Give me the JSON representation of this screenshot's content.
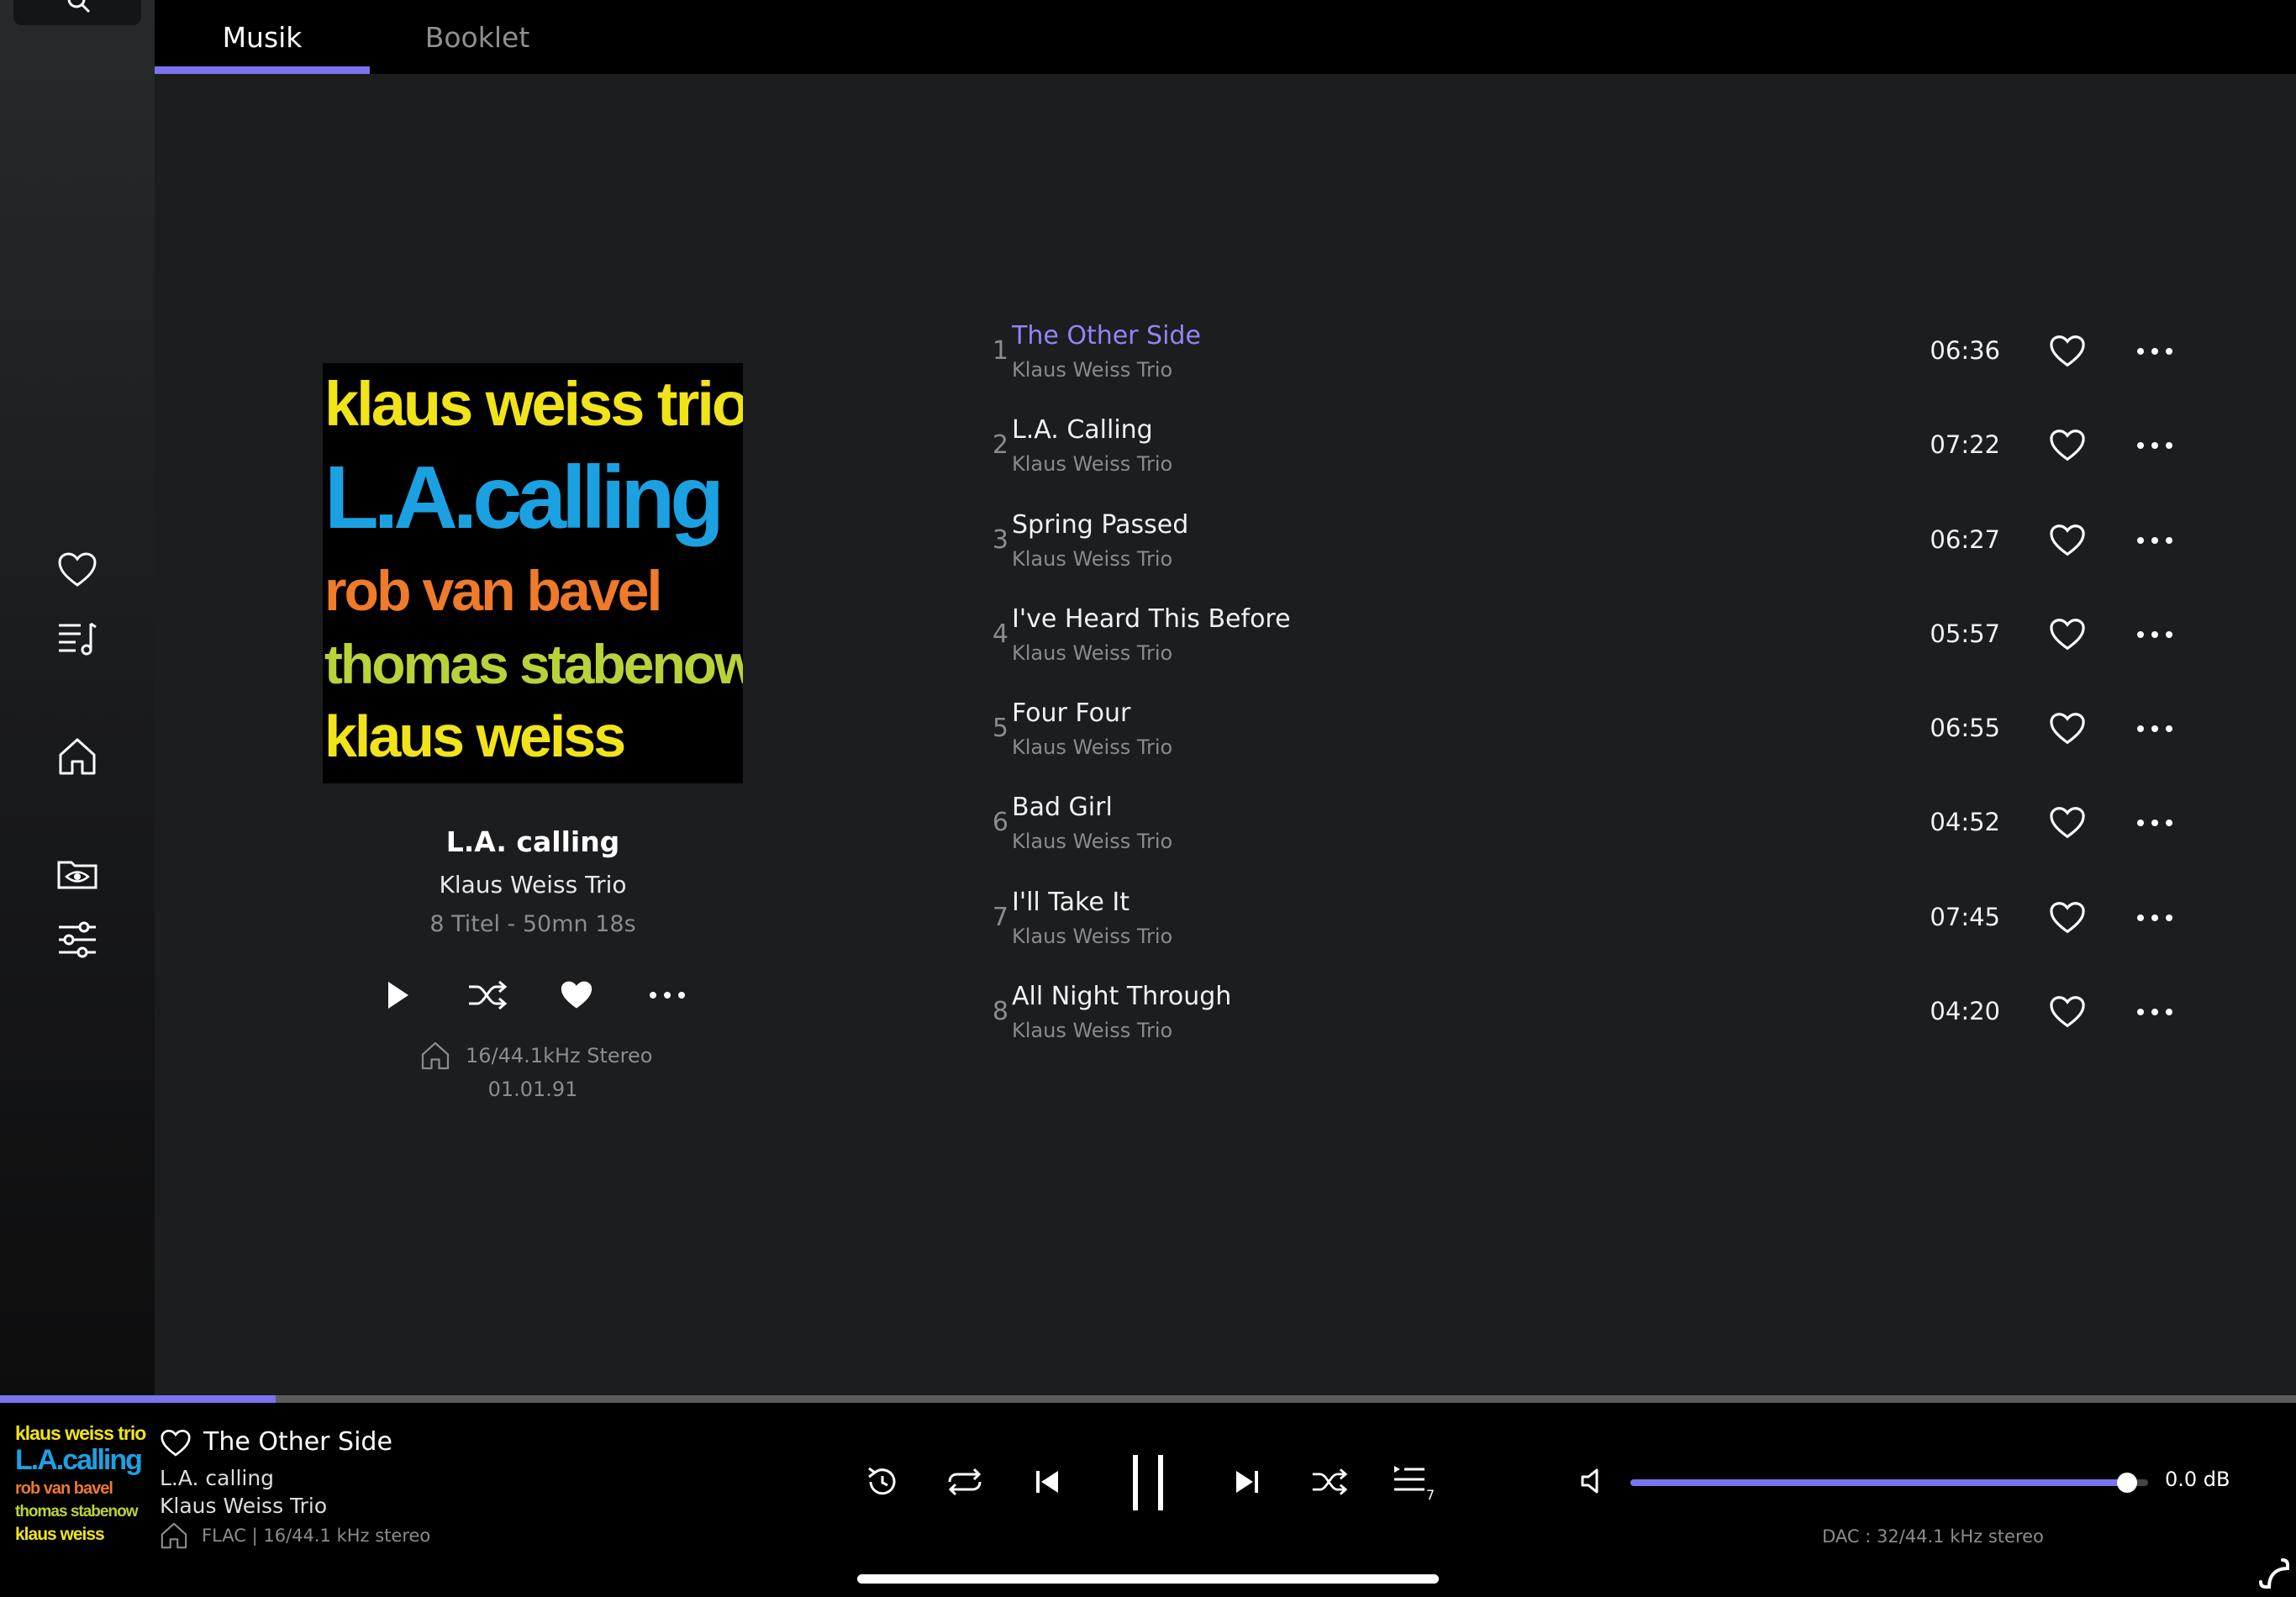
{
  "tabs": [
    {
      "label": "Musik",
      "active": true
    },
    {
      "label": "Booklet",
      "active": false
    }
  ],
  "sidebar": {
    "items": [
      {
        "icon": "heart-icon"
      },
      {
        "icon": "playlist-icon"
      },
      {
        "icon": "home-icon"
      },
      {
        "icon": "folder-eye-icon"
      },
      {
        "icon": "sliders-icon"
      }
    ]
  },
  "album": {
    "cover_lines": [
      "klaus weiss trio",
      "L.A.calling",
      "rob van bavel",
      "thomas stabenow",
      "klaus weiss"
    ],
    "title": "L.A. calling",
    "artist": "Klaus Weiss Trio",
    "meta": "8 Titel - 50mn 18s",
    "format": "16/44.1kHz Stereo",
    "date": "01.01.91"
  },
  "tracks": [
    {
      "num": "1",
      "title": "The Other Side",
      "artist": "Klaus Weiss Trio",
      "duration": "06:36",
      "playing": true
    },
    {
      "num": "2",
      "title": "L.A. Calling",
      "artist": "Klaus Weiss Trio",
      "duration": "07:22",
      "playing": false
    },
    {
      "num": "3",
      "title": "Spring Passed",
      "artist": "Klaus Weiss Trio",
      "duration": "06:27",
      "playing": false
    },
    {
      "num": "4",
      "title": "I've Heard This Before",
      "artist": "Klaus Weiss Trio",
      "duration": "05:57",
      "playing": false
    },
    {
      "num": "5",
      "title": "Four Four",
      "artist": "Klaus Weiss Trio",
      "duration": "06:55",
      "playing": false
    },
    {
      "num": "6",
      "title": "Bad Girl",
      "artist": "Klaus Weiss Trio",
      "duration": "04:52",
      "playing": false
    },
    {
      "num": "7",
      "title": "I'll Take It",
      "artist": "Klaus Weiss Trio",
      "duration": "07:45",
      "playing": false
    },
    {
      "num": "8",
      "title": "All Night Through",
      "artist": "Klaus Weiss Trio",
      "duration": "04:20",
      "playing": false
    }
  ],
  "now_playing": {
    "title": "The Other Side",
    "album": "L.A. calling",
    "artist": "Klaus Weiss Trio",
    "format": "FLAC | 16/44.1 kHz stereo",
    "progress": 0.12,
    "queue_count": "7"
  },
  "volume": {
    "level": 0.96,
    "db": "0.0 dB"
  },
  "dac": "DAC : 32/44.1 kHz stereo",
  "colors": {
    "accent": "#7b73f0",
    "playing_title": "#8f86f5",
    "cover_yellow": "#f1e31a",
    "cover_blue": "#1ba1e2",
    "cover_orange": "#ee7a2a",
    "cover_green": "#b7d33a"
  }
}
